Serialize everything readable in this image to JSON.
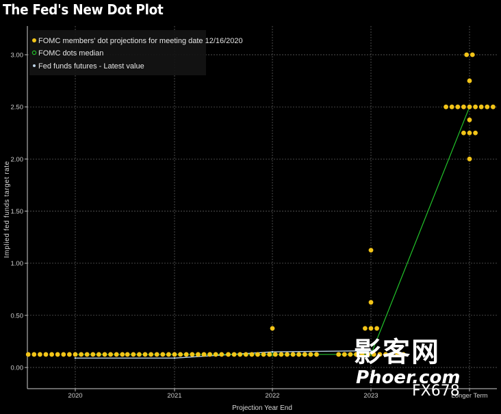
{
  "chart_data": {
    "type": "scatter",
    "title": "The Fed's New Dot Plot",
    "xlabel": "Projection Year End",
    "ylabel": "Implied fed funds target rate",
    "categories": [
      "2020",
      "2021",
      "2022",
      "2023",
      "Longer Term"
    ],
    "ylim": [
      -0.2,
      3.3
    ],
    "yticks": [
      "3.00",
      "2.50",
      "2.00",
      "1.50",
      "1.00",
      "0.50",
      "0.00"
    ],
    "grid": true,
    "legend_position": "top-left",
    "series": [
      {
        "name": "FOMC members' dot projections for meeting date 12/16/2020",
        "color": "#f2c418",
        "points": [
          {
            "x": "2020",
            "values": [
              0.125,
              0.125,
              0.125,
              0.125,
              0.125,
              0.125,
              0.125,
              0.125,
              0.125,
              0.125,
              0.125,
              0.125,
              0.125,
              0.125,
              0.125,
              0.125,
              0.125
            ]
          },
          {
            "x": "2021",
            "values": [
              0.125,
              0.125,
              0.125,
              0.125,
              0.125,
              0.125,
              0.125,
              0.125,
              0.125,
              0.125,
              0.125,
              0.125,
              0.125,
              0.125,
              0.125,
              0.125,
              0.125
            ]
          },
          {
            "x": "2022",
            "values": [
              0.125,
              0.125,
              0.125,
              0.125,
              0.125,
              0.125,
              0.125,
              0.125,
              0.125,
              0.125,
              0.125,
              0.125,
              0.125,
              0.125,
              0.125,
              0.125,
              0.375
            ]
          },
          {
            "x": "2023",
            "values": [
              0.125,
              0.125,
              0.125,
              0.125,
              0.125,
              0.125,
              0.125,
              0.125,
              0.125,
              0.125,
              0.125,
              0.125,
              0.375,
              0.375,
              0.375,
              0.625,
              1.125
            ]
          },
          {
            "x": "Longer Term",
            "values": [
              3.0,
              3.0,
              2.75,
              2.5,
              2.5,
              2.5,
              2.5,
              2.5,
              2.5,
              2.5,
              2.5,
              2.5,
              2.375,
              2.25,
              2.25,
              2.25,
              2.0
            ]
          }
        ]
      },
      {
        "name": "FOMC dots median",
        "color": "#22c42a",
        "x": [
          "2020",
          "2021",
          "2022",
          "2023",
          "Longer Term"
        ],
        "values": [
          0.125,
          0.125,
          0.125,
          0.125,
          2.5
        ]
      },
      {
        "name": "Fed funds futures - Latest value",
        "color": "#bcd4e8",
        "x": [
          "2020",
          "2021",
          "2022",
          "2023"
        ],
        "values": [
          0.09,
          0.09,
          0.15,
          0.16
        ]
      }
    ]
  },
  "watermark": {
    "cn": "影客网",
    "domain": "Phoer.com",
    "brand": "FX678"
  }
}
